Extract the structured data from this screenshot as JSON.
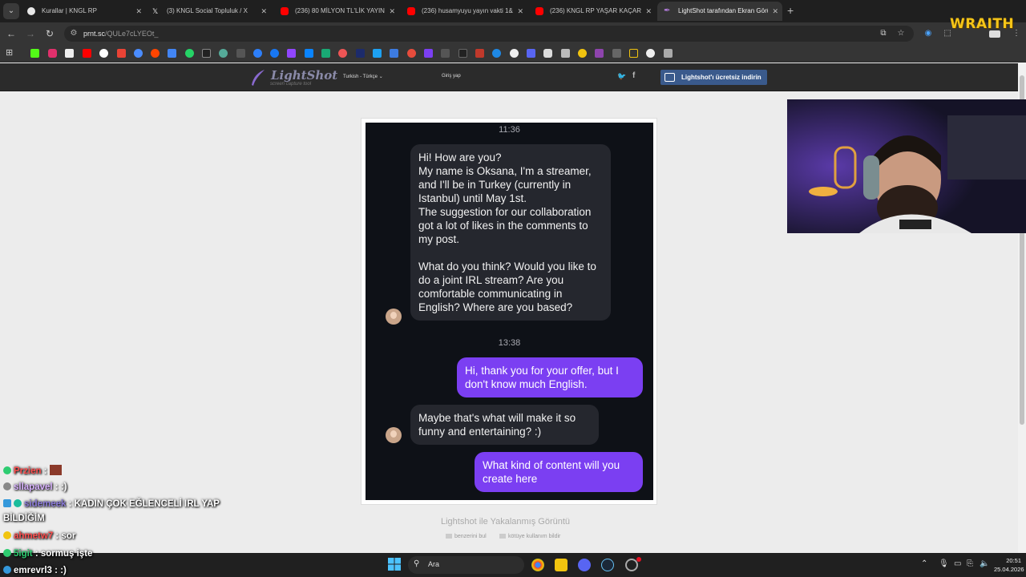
{
  "browser": {
    "tabs": [
      {
        "title": "Kurallar | KNGL RP",
        "icon_color": "#e8e8e8",
        "active": false
      },
      {
        "title": "(3) KNGL Social Topluluk / X",
        "icon_color": "#e8e8e8",
        "active": false
      },
      {
        "title": "(236) 80 MİLYON TL'LİK YAYINC",
        "icon_color": "#ff0000",
        "active": false
      },
      {
        "title": "(236) husamyuyu yayın vakti 1&",
        "icon_color": "#ff0000",
        "active": false
      },
      {
        "title": "(236) KNGL RP YAŞAR KAÇAR -",
        "icon_color": "#ff0000",
        "active": false
      },
      {
        "title": "LightShot tarafından Ekran Görü",
        "icon_color": "#9b59b6",
        "active": true
      }
    ],
    "new_tab": "+",
    "url_host": "prnt.sc",
    "url_path": "/QULe7cLYEOt_"
  },
  "lightshot": {
    "logo": "LightShot",
    "tagline": "screen capture tool",
    "language": "Turkish - Türkçe",
    "language_caret": "⌄",
    "login": "Giriş yap",
    "twitter": "🐦",
    "facebook": "f",
    "download_button": "Lightshot'ı ücretsiz indirin",
    "caption": "Lightshot ile Yakalanmış Görüntü",
    "find_similar": "benzerini bul",
    "report_abuse": "kötüye kullanım bildir"
  },
  "chat_shot": {
    "time1": "11:36",
    "msg1": {
      "p1": "Hi! How are you?",
      "p2": "My name is Oksana, I'm a streamer, and I'll be in Turkey (currently in Istanbul) until May 1st.",
      "p3": "The suggestion for our collaboration got a lot of likes in the comments to my post.",
      "p4": "What do you think? Would you like to do a joint IRL stream? Are you comfortable communicating in English? Where are you based?"
    },
    "time2": "13:38",
    "msg2": "Hi, thank you for your offer, but I don't know much English.",
    "msg3": "Maybe that's what will make it so funny and entertaining? :)",
    "msg4": "What kind of content will you create here"
  },
  "stream_overlay": {
    "brand": "WRAITH",
    "chat": [
      {
        "name": "Przien",
        "message": ":",
        "name_color": "#ff4d4d",
        "badge_color": "#2ecc71"
      },
      {
        "name": "sllapavel",
        "message": ": :)",
        "name_color": "#d9b3ff",
        "badge_color": "#888"
      },
      {
        "name": "sidemeek",
        "message": ": KADIN ÇOK EĞLENCELİ IRL YAP",
        "name_color": "#8a7ad8",
        "badge_color": "#3498db"
      },
      {
        "name": "",
        "message": "BİLDİĞİM",
        "name_color": "#fff",
        "badge_color": ""
      },
      {
        "name": "ahmetw7",
        "message": ": sor",
        "name_color": "#ff4d4d",
        "badge_color": "#f1c40f"
      },
      {
        "name": "5igit",
        "message": ": sormuş işte",
        "name_color": "#2ecc71",
        "badge_color": "#2ecc71"
      },
      {
        "name": "emrevrl3",
        "message": ": :)",
        "name_color": "#ffffff",
        "badge_color": "#3498db"
      }
    ]
  },
  "taskbar": {
    "search_placeholder": "Ara",
    "time": "20:51",
    "date": "25.04.2026"
  },
  "colors": {
    "accent_purple": "#7b3ff2",
    "bubble_gray": "#25272e",
    "lightshot_blue": "#3a5a8c",
    "brand_yellow": "#f5c518"
  }
}
